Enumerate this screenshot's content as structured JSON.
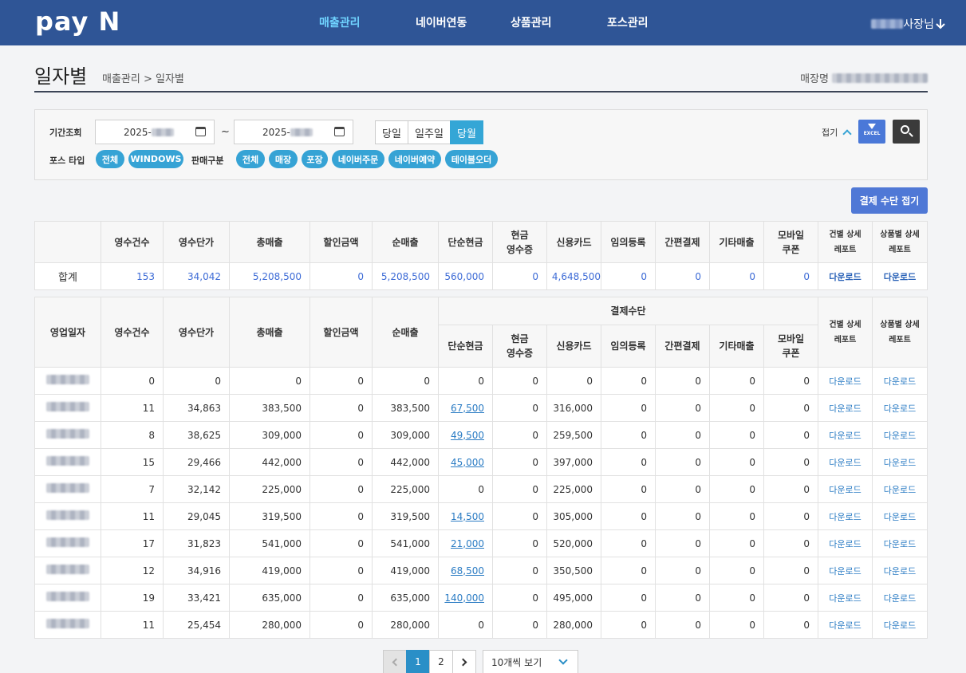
{
  "header": {
    "logo": "pay N",
    "nav": [
      "매출관리",
      "네이버연동",
      "상품관리",
      "포스관리"
    ],
    "user_suffix": "사장님"
  },
  "title": {
    "page": "일자별",
    "breadcrumb": "매출관리 > 일자별",
    "store_label": "매장명"
  },
  "filter": {
    "period_label": "기간조회",
    "date_from": "2025-",
    "date_to": "2025-",
    "range_sep": "~",
    "quick": [
      "당일",
      "일주일",
      "당월"
    ],
    "quick_selected": "당월",
    "pos_type_label": "포스 타입",
    "pos_types": [
      "전체",
      "WINDOWS"
    ],
    "sales_type_label": "판매구분",
    "sales_types": [
      "전체",
      "매장",
      "포장",
      "네이버주문",
      "네이버예약",
      "테이블오더"
    ],
    "fold_label": "접기",
    "excel_label": "EXCEL"
  },
  "payment_toggle": "결제 수단 접기",
  "summary": {
    "headers": [
      "",
      "영수건수",
      "영수단가",
      "총매출",
      "할인금액",
      "순매출",
      "단순현금",
      "현금\n영수증",
      "신용카드",
      "임의등록",
      "간편결제",
      "기타매출",
      "모바일\n쿠폰",
      "건별 상세\n레포트",
      "상품별 상세\n레포트"
    ],
    "row": [
      "합계",
      "153",
      "34,042",
      "5,208,500",
      "0",
      "5,208,500",
      "560,000",
      "0",
      "4,648,500",
      "0",
      "0",
      "0",
      "0",
      "다운로드",
      "다운로드"
    ]
  },
  "daily": {
    "headers": {
      "date": "영업일자",
      "count": "영수건수",
      "unit": "영수단가",
      "total": "총매출",
      "discount": "할인금액",
      "net": "순매출",
      "group": "결제수단",
      "pay": [
        "단순현금",
        "현금\n영수증",
        "신용카드",
        "임의등록",
        "간편결제",
        "기타매출",
        "모바일\n쿠폰"
      ],
      "report1": "건별 상세\n레포트",
      "report2": "상품별 상세\n레포트"
    },
    "rows": [
      [
        "0",
        "0",
        "0",
        "0",
        "0",
        "0",
        "0",
        "0",
        "0",
        "0",
        "0",
        "0"
      ],
      [
        "11",
        "34,863",
        "383,500",
        "0",
        "383,500",
        "67,500",
        "0",
        "316,000",
        "0",
        "0",
        "0",
        "0"
      ],
      [
        "8",
        "38,625",
        "309,000",
        "0",
        "309,000",
        "49,500",
        "0",
        "259,500",
        "0",
        "0",
        "0",
        "0"
      ],
      [
        "15",
        "29,466",
        "442,000",
        "0",
        "442,000",
        "45,000",
        "0",
        "397,000",
        "0",
        "0",
        "0",
        "0"
      ],
      [
        "7",
        "32,142",
        "225,000",
        "0",
        "225,000",
        "0",
        "0",
        "225,000",
        "0",
        "0",
        "0",
        "0"
      ],
      [
        "11",
        "29,045",
        "319,500",
        "0",
        "319,500",
        "14,500",
        "0",
        "305,000",
        "0",
        "0",
        "0",
        "0"
      ],
      [
        "17",
        "31,823",
        "541,000",
        "0",
        "541,000",
        "21,000",
        "0",
        "520,000",
        "0",
        "0",
        "0",
        "0"
      ],
      [
        "12",
        "34,916",
        "419,000",
        "0",
        "419,000",
        "68,500",
        "0",
        "350,500",
        "0",
        "0",
        "0",
        "0"
      ],
      [
        "19",
        "33,421",
        "635,000",
        "0",
        "635,000",
        "140,000",
        "0",
        "495,000",
        "0",
        "0",
        "0",
        "0"
      ],
      [
        "11",
        "25,454",
        "280,000",
        "0",
        "280,000",
        "0",
        "0",
        "280,000",
        "0",
        "0",
        "0",
        "0"
      ]
    ],
    "download": "다운로드"
  },
  "pagination": {
    "pages": [
      "1",
      "2"
    ],
    "current": "1",
    "per_page": "10개씩 보기"
  },
  "colors": {
    "header_bg": "#2f5596",
    "accent": "#36a3d5",
    "excel": "#4a78d8",
    "link": "#2b7cc4"
  }
}
